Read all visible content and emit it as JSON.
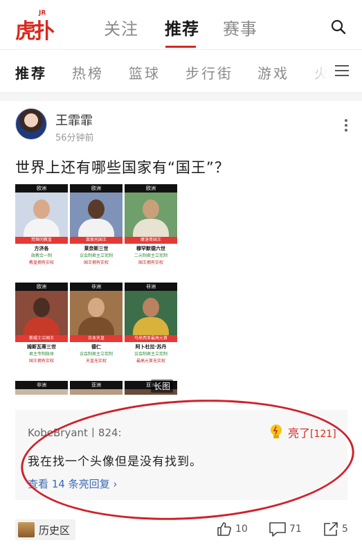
{
  "header": {
    "logo_text": "虎扑",
    "logo_badge": "JR",
    "tabs": [
      {
        "label": "关注",
        "active": false
      },
      {
        "label": "推荐",
        "active": true
      },
      {
        "label": "赛事",
        "active": false
      }
    ],
    "search_icon": "search-icon"
  },
  "categories": [
    {
      "label": "推荐",
      "active": true
    },
    {
      "label": "热榜",
      "active": false
    },
    {
      "label": "篮球",
      "active": false
    },
    {
      "label": "步行街",
      "active": false
    },
    {
      "label": "游戏",
      "active": false
    },
    {
      "label": "火",
      "active": false
    }
  ],
  "post": {
    "author": "王霏霏",
    "time": "56分钟前",
    "title": "世界上还有哪些国家有“国王”？",
    "image_tag": "长图",
    "grid": [
      {
        "region": "欧洲",
        "title": "梵蒂冈教皇",
        "name": "方济各",
        "line1": "政教合一制",
        "line2": "教皇拥有实权"
      },
      {
        "region": "欧洲",
        "title": "莱索托国王",
        "name": "莱奈斯三世",
        "line1": "议会制君主立宪制",
        "line2": "国王拥有实权"
      },
      {
        "region": "欧洲",
        "title": "摩洛哥国王",
        "name": "穆罕默德六世",
        "line1": "二元制君主立宪制",
        "line2": "国王拥有实权"
      },
      {
        "region": "欧洲",
        "title": "斯威士兰国王",
        "name": "姆斯瓦蒂三世",
        "line1": "君主专制政体",
        "line2": "国王拥有实权"
      },
      {
        "region": "非洲",
        "title": "日本天皇",
        "name": "德仁",
        "line1": "议会制君主立宪制",
        "line2": "天皇无实权"
      },
      {
        "region": "非洲",
        "title": "马来西亚最高元首",
        "name": "阿卜杜拉·苏丹",
        "line1": "议会制君主立宪制",
        "line2": "最高元首无实权"
      },
      {
        "region": "非洲",
        "title": "",
        "name": "",
        "line1": "",
        "line2": ""
      },
      {
        "region": "亚洲",
        "title": "",
        "name": "",
        "line1": "",
        "line2": ""
      },
      {
        "region": "亚洲",
        "title": "",
        "name": "",
        "line1": "",
        "line2": ""
      }
    ]
  },
  "highlight_comment": {
    "user": "KobeBryant丨824:",
    "text": "我在找一个头像但是没有找到。",
    "replies": "查看 14 条亮回复",
    "light_label": "亮了",
    "light_count": "[121]"
  },
  "footer": {
    "tag": "历史区",
    "likes": "10",
    "comments": "71",
    "shares": "5"
  },
  "colors": {
    "brand": "#d8281e",
    "link": "#3a6bb5"
  }
}
